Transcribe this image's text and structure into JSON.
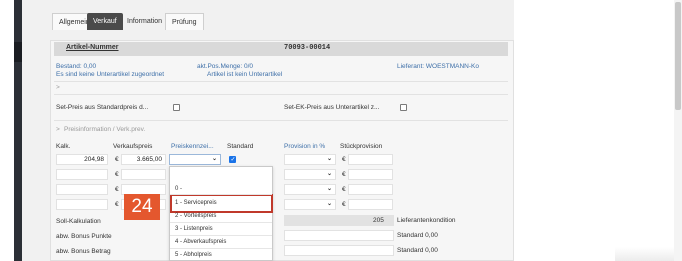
{
  "tabs": [
    "Allgemein",
    "Verkauf",
    "Information",
    "Prüfung"
  ],
  "article": {
    "label": "Artikel-Nummer",
    "value": "70093-00014"
  },
  "info": {
    "bestand": "Bestand: 0,00",
    "akt_pos": "akt.Pos.Menge: 0/0",
    "lieferant": "Lieferant: WOESTMANN-Ko",
    "unterartikel": "Es sind keine Unterartikel zugeordnet",
    "kein_unterartikel": "Artikel ist kein Unterartikel"
  },
  "expand_marker": ">",
  "set_preis_label": "Set-Preis aus Standardpreis d...",
  "set_ek_label": "Set-EK-Preis aus Unterartikel z...",
  "section": {
    "marker": ">",
    "title": "Preisinformation / Verk.prev."
  },
  "columns": {
    "kalk": "Kalk.",
    "verkaufspreis": "Verkaufspreis",
    "preiskennzei": "Preiskennzei...",
    "standard": "Standard",
    "provision": "Provision in %",
    "stueckprovision": "Stückprovision"
  },
  "rows": [
    {
      "kalk": "204,98",
      "currency": "€",
      "price": "3.665,00",
      "prov_currency": "€"
    },
    {
      "kalk": "",
      "currency": "€",
      "price": "",
      "prov_currency": "€"
    },
    {
      "kalk": "",
      "currency": "€",
      "price": "",
      "prov_currency": "€"
    },
    {
      "kalk": "",
      "currency": "€",
      "price": "",
      "prov_currency": "€"
    }
  ],
  "dropdown": {
    "options": [
      "0 -",
      "1 - Servicepreis",
      "2 - Vorteilspreis",
      "3 - Listenpreis",
      "4 - Abverkaufspreis",
      "5 - Abholpreis"
    ],
    "highlighted": "1 - Servicepreis"
  },
  "step_badge": "24",
  "soll_kalkulation": "Soll-Kalkulation",
  "soll_value": "205",
  "abw_bonus_punkte": "abw. Bonus Punkte",
  "abw_bonus_betrag": "abw. Bonus Betrag",
  "lieferantenkondition": "Lieferantenkondition",
  "standard_1": "Standard 0,00",
  "standard_2": "Standard 0,00",
  "colors": {
    "accent_blue": "#3d6fa8",
    "badge": "#e4572e",
    "highlight_border": "#c0392b"
  }
}
